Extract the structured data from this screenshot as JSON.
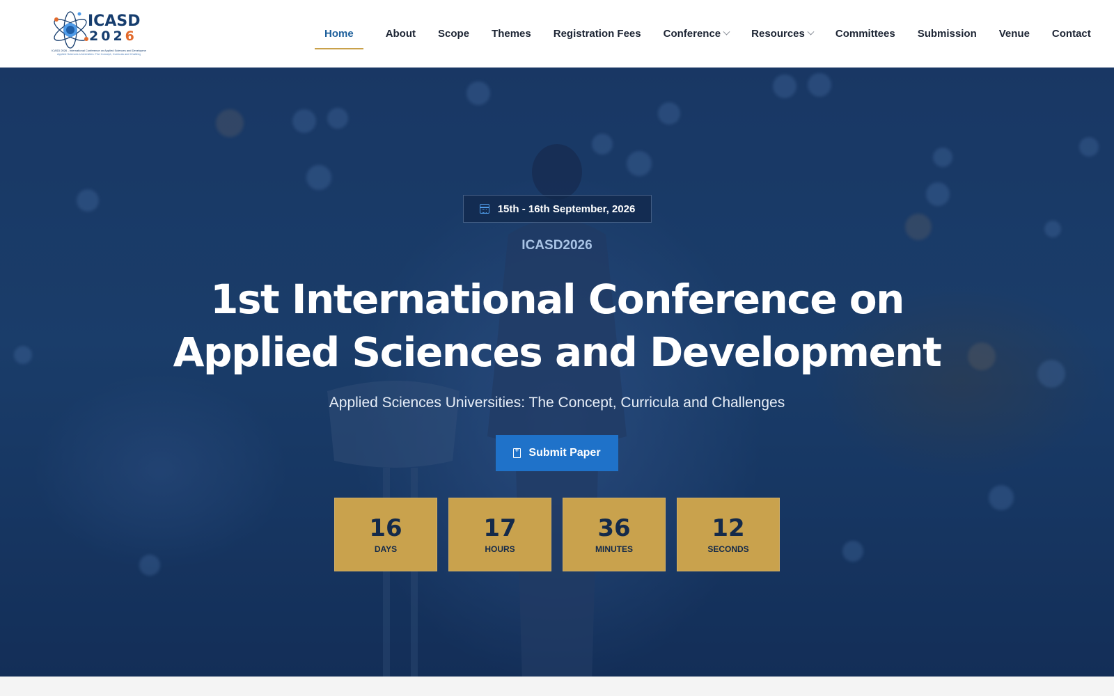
{
  "logo": {
    "title": "ICASD",
    "year_main": "202",
    "year_accent": "6",
    "tagline": "ICASD 2026 - International Conference on Applied Sciences and Development",
    "tagline2": "Applied Sciences Universities: The Concept, Curricula and Challenges"
  },
  "nav": {
    "items": [
      {
        "label": "Home",
        "active": true
      },
      {
        "label": "About"
      },
      {
        "label": "Scope"
      },
      {
        "label": "Themes"
      },
      {
        "label": "Registration Fees"
      },
      {
        "label": "Conference",
        "dropdown": true
      },
      {
        "label": "Resources",
        "dropdown": true
      },
      {
        "label": "Committees"
      },
      {
        "label": "Submission"
      },
      {
        "label": "Venue"
      },
      {
        "label": "Contact"
      }
    ]
  },
  "hero": {
    "date": "15th - 16th September, 2026",
    "kicker": "ICASD2026",
    "title_line1": "1st International Conference on",
    "title_line2": "Applied Sciences and Development",
    "subtitle": "Applied Sciences Universities: The Concept, Curricula and Challenges",
    "submit_label": "Submit Paper"
  },
  "countdown": {
    "days": {
      "value": "16",
      "label": "DAYS"
    },
    "hours": {
      "value": "17",
      "label": "HOURS"
    },
    "minutes": {
      "value": "36",
      "label": "MINUTES"
    },
    "seconds": {
      "value": "12",
      "label": "SECONDS"
    }
  },
  "colors": {
    "brand": "#163d6e",
    "accent": "#c9a24d",
    "button": "#1f72c9",
    "active_nav": "#1d5f9b"
  },
  "icons": [
    "atom-logo-icon",
    "calendar-icon",
    "file-upload-icon",
    "chevron-down-icon"
  ]
}
